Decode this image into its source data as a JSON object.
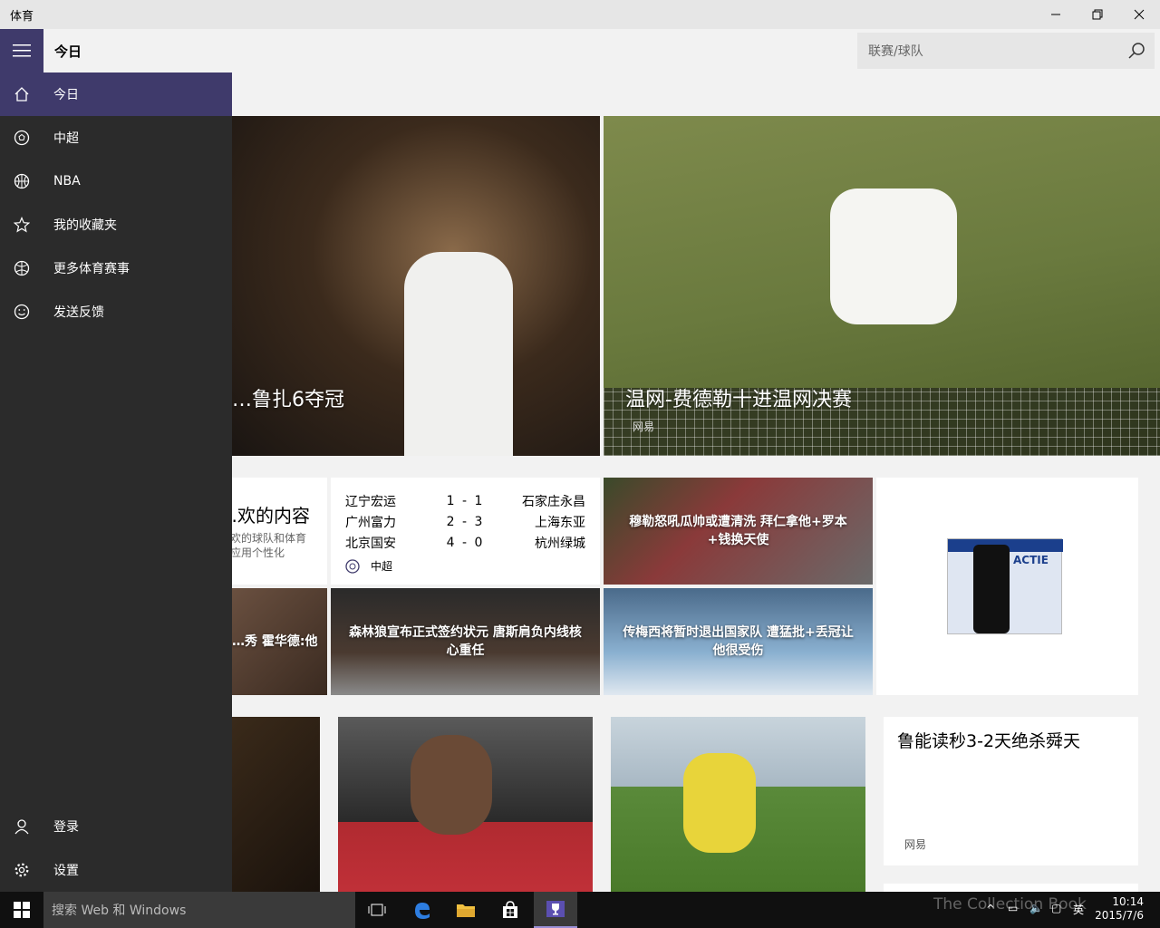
{
  "window": {
    "title": "体育"
  },
  "header": {
    "page_title": "今日",
    "search_placeholder": "联赛/球队"
  },
  "sidebar": {
    "items": [
      {
        "label": "今日",
        "icon": "home-icon"
      },
      {
        "label": "中超",
        "icon": "soccer-ball-icon"
      },
      {
        "label": "NBA",
        "icon": "basketball-icon"
      },
      {
        "label": "我的收藏夹",
        "icon": "star-icon"
      },
      {
        "label": "更多体育赛事",
        "icon": "sports-ball-icon"
      },
      {
        "label": "发送反馈",
        "icon": "smiley-icon"
      }
    ],
    "bottom_items": [
      {
        "label": "登录",
        "icon": "person-icon"
      },
      {
        "label": "设置",
        "icon": "gear-icon"
      }
    ]
  },
  "hero": [
    {
      "title": "…鲁扎6夺冠"
    },
    {
      "title": "温网-费德勒十进温网决赛",
      "source": "网易"
    }
  ],
  "personalize": {
    "heading": "…欢的内容",
    "line1": "…欢的球队和体育",
    "line2": "…应用个性化"
  },
  "scores": {
    "rows": [
      {
        "home": "辽宁宏运",
        "score": "1 - 1",
        "away": "石家庄永昌"
      },
      {
        "home": "广州富力",
        "score": "2 - 3",
        "away": "上海东亚"
      },
      {
        "home": "北京国安",
        "score": "4 - 0",
        "away": "杭州绿城"
      }
    ],
    "league": "中超"
  },
  "news": [
    {
      "title": "穆勒怒吼瓜帅或遭清洗 拜仁拿他+罗本+钱换天使"
    },
    {
      "title": "…秀 霍华德:他"
    },
    {
      "title": "森林狼宣布正式签约状元 唐斯肩负内线核心重任"
    },
    {
      "title": "传梅西将暂时退出国家队 遭猛批+丢冠让他很受伤"
    }
  ],
  "ad": {
    "label": "ACTIE"
  },
  "bottom_news": {
    "title": "鲁能读秒3-2天绝杀舜天",
    "source": "网易"
  },
  "taskbar": {
    "search_placeholder": "搜索 Web 和 Windows",
    "time": "10:14",
    "date": "2015/7/6",
    "ime": "英",
    "watermark": "The Collection Book"
  }
}
